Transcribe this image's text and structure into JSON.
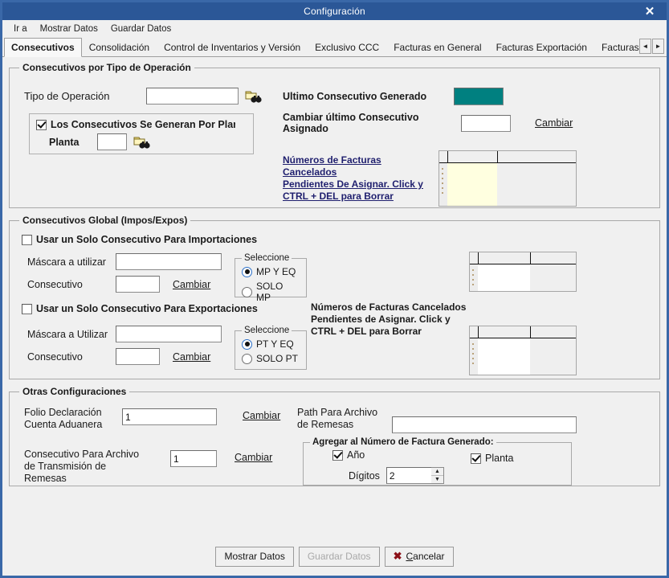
{
  "window": {
    "title": "Configuración",
    "close_label": "✕"
  },
  "menubar": {
    "items": [
      {
        "label": "Ir a"
      },
      {
        "label": "Mostrar Datos"
      },
      {
        "label": "Guardar Datos"
      }
    ]
  },
  "tabs": {
    "items": [
      {
        "label": "Consecutivos",
        "active": true
      },
      {
        "label": "Consolidación",
        "active": false
      },
      {
        "label": "Control de Inventarios y Versión",
        "active": false
      },
      {
        "label": "Exclusivo CCC",
        "active": false
      },
      {
        "label": "Facturas en General",
        "active": false
      },
      {
        "label": "Facturas Exportación",
        "active": false
      },
      {
        "label": "Facturas In",
        "active": false
      }
    ],
    "scroll_left": "◄",
    "scroll_right": "►"
  },
  "group_tipo_operacion": {
    "legend": "Consecutivos por Tipo de Operación",
    "tipo_operacion_label": "Tipo de Operación",
    "tipo_operacion_value": "",
    "browse_icon": "folder-binoculars-icon",
    "planta_checkbox_label": "Los Consecutivos Se Generan Por Planta",
    "planta_checkbox_checked": true,
    "planta_label": "Planta",
    "planta_value": "",
    "planta_browse_icon": "folder-binoculars-icon",
    "ultimo_consecutivo_label": "Ultimo Consecutivo Generado",
    "ultimo_consecutivo_value": "",
    "ultimo_consecutivo_color": "#008080",
    "cambiar_ultimo_label": "Cambiar último Consecutivo Asignado",
    "cambiar_ultimo_value": "",
    "cambiar_link": "Cambiar",
    "cancelados_link_line1": "Números de Facturas Cancelados",
    "cancelados_link_line2": "Pendientes De Asignar. Click y",
    "cancelados_link_line3": "CTRL + DEL para Borrar",
    "grid_rows": []
  },
  "group_global": {
    "legend": "Consecutivos Global (Impos/Expos)",
    "importaciones": {
      "checkbox_label": "Usar un Solo Consecutivo Para Importaciones",
      "checkbox_checked": false,
      "mascara_label": "Máscara a utilizar",
      "mascara_value": "",
      "consecutivo_label": "Consecutivo",
      "consecutivo_value": "",
      "cambiar_link": "Cambiar",
      "seleccione_legend": "Seleccione",
      "options": [
        {
          "label": "MP Y EQ",
          "selected": true
        },
        {
          "label": "SOLO MP",
          "selected": false
        }
      ]
    },
    "exportaciones": {
      "checkbox_label": "Usar un Solo Consecutivo Para Exportaciones",
      "checkbox_checked": false,
      "mascara_label": "Máscara a Utilizar",
      "mascara_value": "",
      "consecutivo_label": "Consecutivo",
      "consecutivo_value": "",
      "cambiar_link": "Cambiar",
      "seleccione_legend": "Seleccione",
      "options": [
        {
          "label": "PT Y EQ",
          "selected": true
        },
        {
          "label": "SOLO PT",
          "selected": false
        }
      ]
    },
    "cancelados_line1": "Números de Facturas Cancelados",
    "cancelados_line2": "Pendientes de Asignar. Click y",
    "cancelados_line3": "CTRL + DEL para Borrar",
    "grid_top_rows": [],
    "grid_bottom_rows": []
  },
  "group_otras": {
    "legend": "Otras Configuraciones",
    "folio_label_line1": "Folio Declaración",
    "folio_label_line2": "Cuenta Aduanera",
    "folio_value": "1",
    "folio_cambiar_link": "Cambiar",
    "remesas_label_line1": "Consecutivo Para Archivo",
    "remesas_label_line2": "de Transmisión  de",
    "remesas_label_line3": "Remesas",
    "remesas_value": "1",
    "remesas_cambiar_link": "Cambiar",
    "path_label_line1": "Path Para Archivo",
    "path_label_line2": "de Remesas",
    "path_value": "",
    "agregar_legend": "Agregar al Número de Factura Generado:",
    "anio_label": "Año",
    "anio_checked": true,
    "digitos_label": "Dígitos",
    "digitos_value": "2",
    "planta_label": "Planta",
    "planta_checked": true
  },
  "footer": {
    "mostrar_datos": "Mostrar Datos",
    "guardar_datos": "Guardar Datos",
    "guardar_datos_disabled": true,
    "cancelar": "Cancelar",
    "cancelar_icon": "x-mark-icon"
  }
}
